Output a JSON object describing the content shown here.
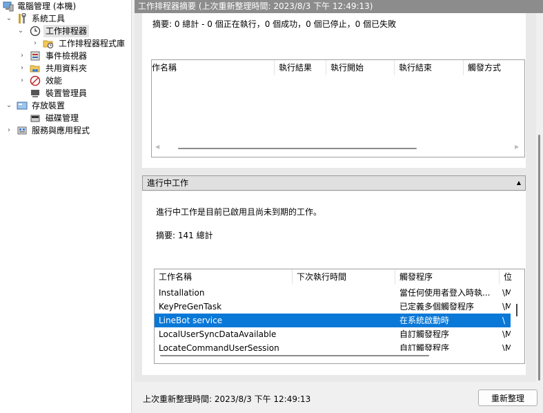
{
  "tree": {
    "root": "電腦管理 (本機)",
    "system_tools": "系統工具",
    "task_scheduler": "工作排程器",
    "task_scheduler_library": "工作排程器程式庫",
    "event_viewer": "事件檢視器",
    "shared_folders": "共用資料夾",
    "performance": "效能",
    "device_manager": "裝置管理員",
    "storage": "存放裝置",
    "disk_management": "磁碟管理",
    "services_apps": "服務與應用程式"
  },
  "titlebar": "工作排程器摘要 (上次重新整理時間: 2023/8/3 下午 12:49:13)",
  "status_section": {
    "summary": "摘要: 0 總計 - 0 個正在執行，0 個成功，0 個已停止，0 個已失敗",
    "columns": [
      "作名稱",
      "執行結果",
      "執行開始",
      "執行結束",
      "觸發方式"
    ]
  },
  "active_section": {
    "header": "進行中工作",
    "description": "進行中工作是目前已啟用且尚未到期的工作。",
    "summary": "摘要: 141 總計",
    "columns": [
      "工作名稱",
      "下次執行時間",
      "觸發程序",
      "位"
    ],
    "rows": [
      {
        "name": "Installation",
        "next_run": "",
        "trigger": "當任何使用者登入時執...",
        "loc": "\\M"
      },
      {
        "name": "KeyPreGenTask",
        "next_run": "",
        "trigger": "已定義多個觸發程序",
        "loc": "\\M"
      },
      {
        "name": "LineBot service",
        "next_run": "",
        "trigger": "在系統啟動時",
        "loc": "\\",
        "selected": true
      },
      {
        "name": "LocalUserSyncDataAvailable",
        "next_run": "",
        "trigger": "自訂觸發程序",
        "loc": "\\M"
      },
      {
        "name": "LocateCommandUserSession",
        "next_run": "",
        "trigger": "自訂觸發程序",
        "loc": "\\M"
      }
    ]
  },
  "bottom": {
    "last_refresh": "上次重新整理時間: 2023/8/3 下午 12:49:13",
    "refresh_button": "重新整理"
  }
}
